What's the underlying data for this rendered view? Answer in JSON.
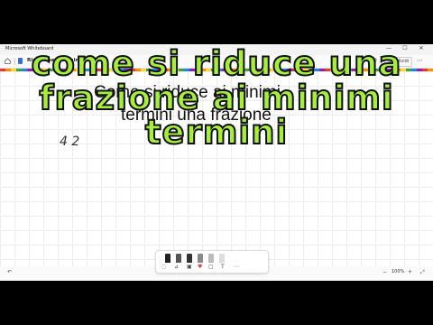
{
  "window": {
    "title": "Microsoft Whiteboard",
    "min": "—",
    "max": "☐",
    "close": "✕"
  },
  "toolbar": {
    "doc_title": "Riduzione ai minimi termini",
    "chevron": "⌄",
    "share_label": "Condividi",
    "icons": [
      "undo",
      "redo",
      "settings",
      "more"
    ]
  },
  "canvas": {
    "heading_line1": "Come si riduce ai minimi",
    "heading_line2": "termini una frazione",
    "sketch_text": "4 2"
  },
  "overlay": {
    "line1": "come si riduce una",
    "line2": "frazione ai  minimi",
    "line3": "termini",
    "color": "#a6ee3b"
  },
  "penbar": {
    "pens": [
      {
        "name": "pen-black",
        "color": "#222222"
      },
      {
        "name": "pen-gray",
        "color": "#555555"
      },
      {
        "name": "pen-dark",
        "color": "#333333"
      },
      {
        "name": "pen-light",
        "color": "#888888"
      },
      {
        "name": "highlighter",
        "color": "#bbbbbb"
      },
      {
        "name": "eraser",
        "color": "#dddddd"
      }
    ],
    "tools": [
      "lasso-icon",
      "ruler-icon",
      "image-icon",
      "heart-icon",
      "note-icon",
      "text-icon",
      "more-icon"
    ]
  },
  "status": {
    "zoom": "100%",
    "zoom_out": "−",
    "zoom_in": "+"
  }
}
